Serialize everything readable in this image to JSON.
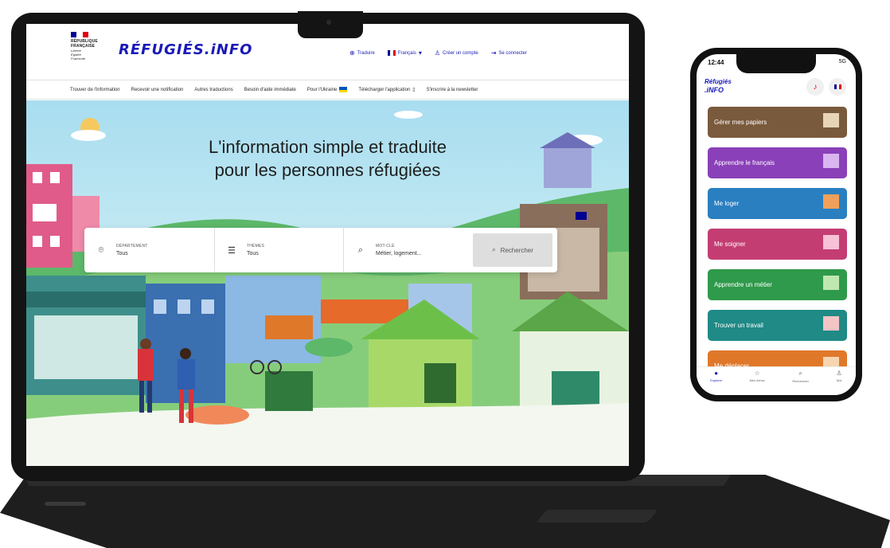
{
  "colors": {
    "brand": "#1a1ab8",
    "gov_red": "#e1000f",
    "laptop": "#141414"
  },
  "website": {
    "gov_logo": {
      "lines": [
        "RÉPUBLIQUE",
        "FRANÇAISE",
        "Liberté",
        "Égalité",
        "Fraternité"
      ]
    },
    "site_logo": "RÉFUGIÉS.iNFO",
    "header_links": [
      {
        "icon": "globe-icon",
        "label": "Traduire"
      },
      {
        "icon": "flag-fr-icon",
        "label": "Français"
      },
      {
        "icon": "user-icon",
        "label": "Créer un compte"
      },
      {
        "icon": "login-icon",
        "label": "Se connecter"
      }
    ],
    "nav": [
      "Trouver de l'information",
      "Recevoir une notification",
      "Autres traductions",
      "Besoin d'aide immédiate",
      "Pour l'Ukraine",
      "Télécharger l'application",
      "S'inscrire à la newsletter"
    ],
    "hero": {
      "title_line1": "L'information simple et traduite",
      "title_line2": "pour les personnes réfugiées"
    },
    "search": {
      "fields": [
        {
          "icon": "location-icon",
          "label": "DÉPARTEMENT",
          "value": "Tous"
        },
        {
          "icon": "list-icon",
          "label": "THÈMES",
          "value": "Tous"
        },
        {
          "icon": "search-icon",
          "label": "MOT-CLÉ",
          "value": "Métier, logement..."
        }
      ],
      "button": "Rechercher"
    }
  },
  "phone": {
    "time": "12:44",
    "status": "5G",
    "logo_line1": "Réfugiés",
    "logo_line2": ".iNFO",
    "cards": [
      {
        "label": "Gérer mes papiers",
        "color": "#7a5a3c"
      },
      {
        "label": "Apprendre le français",
        "color": "#8a40b8"
      },
      {
        "label": "Me loger",
        "color": "#2a7fc0"
      },
      {
        "label": "Me soigner",
        "color": "#c43d72"
      },
      {
        "label": "Apprendre un métier",
        "color": "#2f9a4b"
      },
      {
        "label": "Trouver un travail",
        "color": "#1f8a86"
      },
      {
        "label": "Me déplacer",
        "color": "#e0782a"
      }
    ],
    "tabs": [
      {
        "icon": "home-icon",
        "label": "Explorer"
      },
      {
        "icon": "star-icon",
        "label": "Mes fiches"
      },
      {
        "icon": "search-icon",
        "label": "Rechercher"
      },
      {
        "icon": "profile-icon",
        "label": "Moi"
      }
    ]
  }
}
